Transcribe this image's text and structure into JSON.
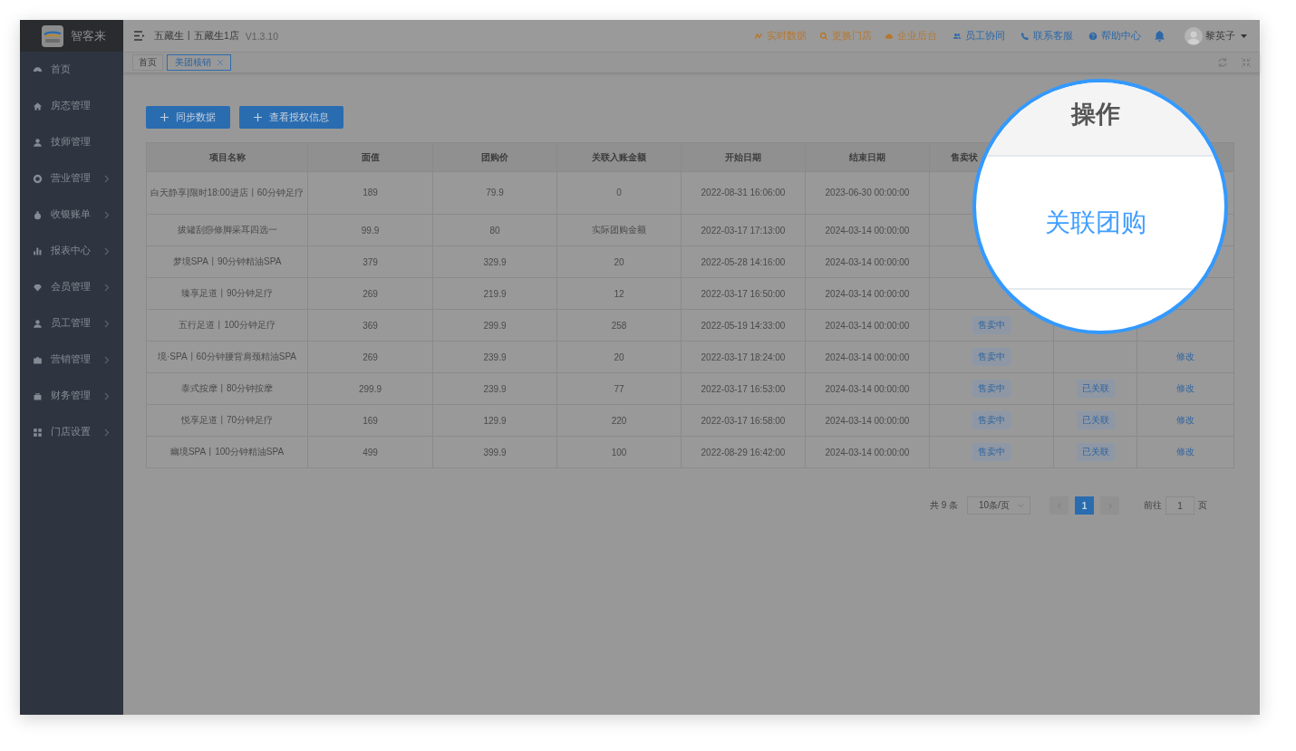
{
  "app": {
    "name": "智客来"
  },
  "sidebar": {
    "items": [
      {
        "label": "首页",
        "expandable": false
      },
      {
        "label": "房态管理",
        "expandable": false
      },
      {
        "label": "技师管理",
        "expandable": false
      },
      {
        "label": "营业管理",
        "expandable": true
      },
      {
        "label": "收银账单",
        "expandable": true
      },
      {
        "label": "报表中心",
        "expandable": true
      },
      {
        "label": "会员管理",
        "expandable": true
      },
      {
        "label": "员工管理",
        "expandable": true
      },
      {
        "label": "营销管理",
        "expandable": true
      },
      {
        "label": "财务管理",
        "expandable": true
      },
      {
        "label": "门店设置",
        "expandable": true
      }
    ]
  },
  "topbar": {
    "store": "五藏生丨五藏生1店",
    "version": "V1.3.10",
    "links": [
      {
        "label": "实时数据",
        "color": "#b8772e"
      },
      {
        "label": "更换门店",
        "color": "#b8772e"
      },
      {
        "label": "企业后台",
        "color": "#b8772e"
      },
      {
        "label": "员工协同",
        "color": "#2d68a8"
      },
      {
        "label": "联系客服",
        "color": "#2d68a8"
      },
      {
        "label": "帮助中心",
        "color": "#2d68a8"
      }
    ],
    "user": "黎英子"
  },
  "tabs": [
    {
      "label": "首页",
      "selected": false,
      "closable": false
    },
    {
      "label": "美团核销",
      "selected": true,
      "closable": true
    }
  ],
  "buttons": [
    "同步数据",
    "查看授权信息"
  ],
  "table": {
    "columns": [
      "项目名称",
      "面值",
      "团购价",
      "关联入账金额",
      "开始日期",
      "结束日期",
      "售卖状"
    ],
    "rows": [
      {
        "cells": [
          "白天静享|限时18:00进店丨60分钟足疗",
          "189",
          "79.9",
          "0",
          "2022-08-31 16:06:00",
          "2023-06-30 00:00:00"
        ]
      },
      {
        "cells": [
          "拔罐刮痧修脚采耳四选一",
          "99.9",
          "80",
          "实际团购金额",
          "2022-03-17 17:13:00",
          "2024-03-14 00:00:00"
        ]
      },
      {
        "cells": [
          "梦境SPA丨90分钟精油SPA",
          "379",
          "329.9",
          "20",
          "2022-05-28 14:16:00",
          "2024-03-14 00:00:00"
        ]
      },
      {
        "cells": [
          "臻享足道丨90分钟足疗",
          "269",
          "219.9",
          "12",
          "2022-03-17 16:50:00",
          "2024-03-14 00:00:00"
        ]
      },
      {
        "cells": [
          "五行足道丨100分钟足疗",
          "369",
          "299.9",
          "258",
          "2022-05-19 14:33:00",
          "2024-03-14 00:00:00"
        ],
        "status": "售卖中"
      },
      {
        "cells": [
          "境·SPA丨60分钟腰背肩颈精油SPA",
          "269",
          "239.9",
          "20",
          "2022-03-17 18:24:00",
          "2024-03-14 00:00:00"
        ],
        "status": "售卖中",
        "action": "修改"
      },
      {
        "cells": [
          "泰式按摩丨80分钟按摩",
          "299.9",
          "239.9",
          "77",
          "2022-03-17 16:53:00",
          "2024-03-14 00:00:00"
        ],
        "status": "售卖中",
        "link": "已关联",
        "action": "修改"
      },
      {
        "cells": [
          "悦享足道丨70分钟足疗",
          "169",
          "129.9",
          "220",
          "2022-03-17 16:58:00",
          "2024-03-14 00:00:00"
        ],
        "status": "售卖中",
        "link": "已关联",
        "action": "修改"
      },
      {
        "cells": [
          "幽境SPA丨100分钟精油SPA",
          "499",
          "399.9",
          "100",
          "2022-08-29 16:42:00",
          "2024-03-14 00:00:00"
        ],
        "status": "售卖中",
        "link": "已关联",
        "action": "修改"
      }
    ]
  },
  "pagination": {
    "total": "共 9 条",
    "page_size": "10条/页",
    "pages": [
      {
        "label": "1",
        "selected": true
      }
    ],
    "goto_label": "前往",
    "goto_value": "1",
    "suffix": "页"
  },
  "magnifier": {
    "header": "操作",
    "link": "关联团购"
  }
}
